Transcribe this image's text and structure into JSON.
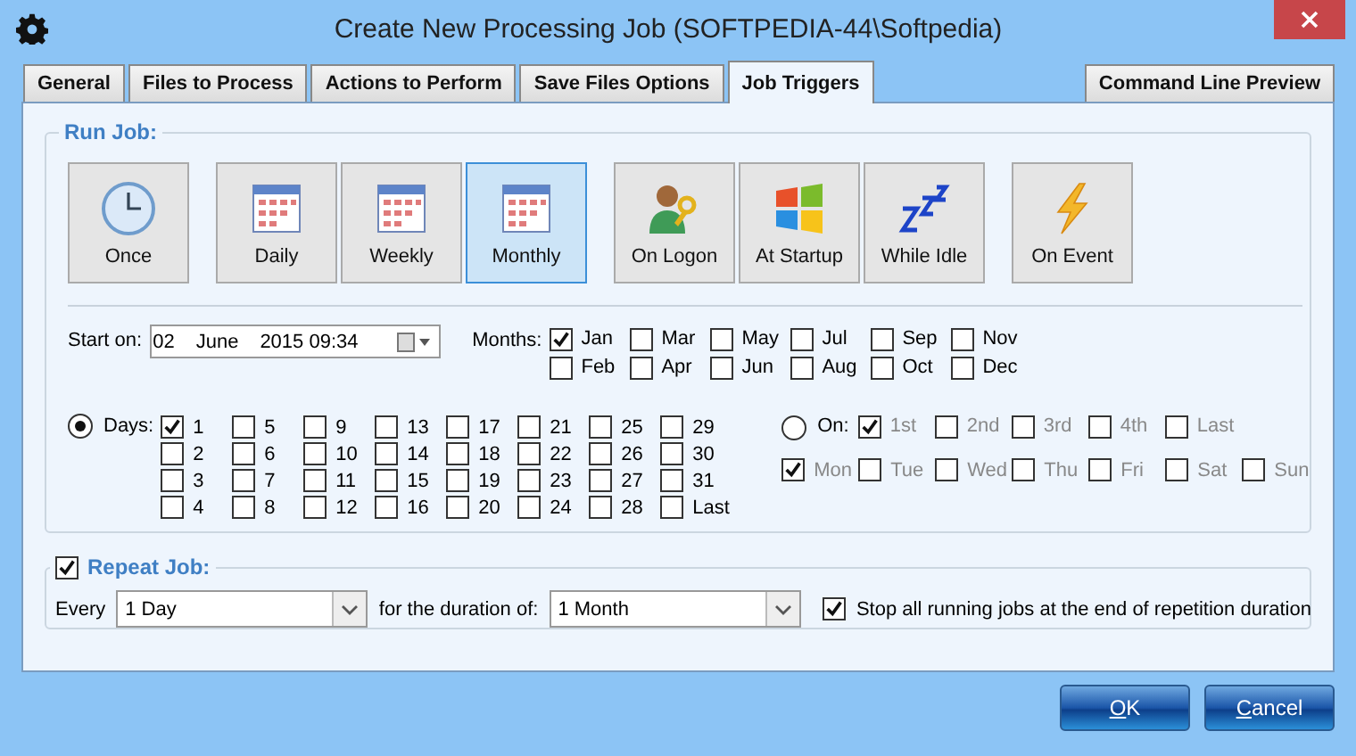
{
  "window": {
    "title": "Create New Processing Job (SOFTPEDIA-44\\Softpedia)"
  },
  "tabs": [
    {
      "label": "General",
      "selected": false
    },
    {
      "label": "Files to Process",
      "selected": false
    },
    {
      "label": "Actions to Perform",
      "selected": false
    },
    {
      "label": "Save Files Options",
      "selected": false
    },
    {
      "label": "Job Triggers",
      "selected": true
    }
  ],
  "side_tab": {
    "label": "Command Line Preview",
    "selected": false
  },
  "run_job": {
    "title": "Run Job:",
    "trigger_groups": [
      [
        {
          "label": "Once",
          "kind": "clock",
          "selected": false
        }
      ],
      [
        {
          "label": "Daily",
          "kind": "calendar",
          "selected": false
        },
        {
          "label": "Weekly",
          "kind": "calendar",
          "selected": false
        },
        {
          "label": "Monthly",
          "kind": "calendar",
          "selected": true
        }
      ],
      [
        {
          "label": "On Logon",
          "kind": "user",
          "selected": false
        },
        {
          "label": "At Startup",
          "kind": "flag",
          "selected": false
        },
        {
          "label": "While Idle",
          "kind": "sleep",
          "selected": false
        }
      ],
      [
        {
          "label": "On Event",
          "kind": "bolt",
          "selected": false
        }
      ]
    ]
  },
  "start_on": {
    "label": "Start on:",
    "day": "02",
    "month": "June",
    "year_time": "2015 09:34"
  },
  "months": {
    "label": "Months:",
    "items": [
      {
        "label": "Jan",
        "checked": true
      },
      {
        "label": "Feb",
        "checked": false
      },
      {
        "label": "Mar",
        "checked": false
      },
      {
        "label": "Apr",
        "checked": false
      },
      {
        "label": "May",
        "checked": false
      },
      {
        "label": "Jun",
        "checked": false
      },
      {
        "label": "Jul",
        "checked": false
      },
      {
        "label": "Aug",
        "checked": false
      },
      {
        "label": "Sep",
        "checked": false
      },
      {
        "label": "Oct",
        "checked": false
      },
      {
        "label": "Nov",
        "checked": false
      },
      {
        "label": "Dec",
        "checked": false
      }
    ]
  },
  "days": {
    "label": "Days:",
    "selected": true,
    "items": [
      {
        "label": "1",
        "checked": true
      },
      {
        "label": "2",
        "checked": false
      },
      {
        "label": "3",
        "checked": false
      },
      {
        "label": "4",
        "checked": false
      },
      {
        "label": "5",
        "checked": false
      },
      {
        "label": "6",
        "checked": false
      },
      {
        "label": "7",
        "checked": false
      },
      {
        "label": "8",
        "checked": false
      },
      {
        "label": "9",
        "checked": false
      },
      {
        "label": "10",
        "checked": false
      },
      {
        "label": "11",
        "checked": false
      },
      {
        "label": "12",
        "checked": false
      },
      {
        "label": "13",
        "checked": false
      },
      {
        "label": "14",
        "checked": false
      },
      {
        "label": "15",
        "checked": false
      },
      {
        "label": "16",
        "checked": false
      },
      {
        "label": "17",
        "checked": false
      },
      {
        "label": "18",
        "checked": false
      },
      {
        "label": "19",
        "checked": false
      },
      {
        "label": "20",
        "checked": false
      },
      {
        "label": "21",
        "checked": false
      },
      {
        "label": "22",
        "checked": false
      },
      {
        "label": "23",
        "checked": false
      },
      {
        "label": "24",
        "checked": false
      },
      {
        "label": "25",
        "checked": false
      },
      {
        "label": "26",
        "checked": false
      },
      {
        "label": "27",
        "checked": false
      },
      {
        "label": "28",
        "checked": false
      },
      {
        "label": "29",
        "checked": false
      },
      {
        "label": "30",
        "checked": false
      },
      {
        "label": "31",
        "checked": false
      },
      {
        "label": "Last",
        "checked": false
      }
    ]
  },
  "on": {
    "label": "On:",
    "selected": false,
    "disabled": true,
    "ordinals": [
      {
        "label": "1st",
        "checked": true
      },
      {
        "label": "2nd",
        "checked": false
      },
      {
        "label": "3rd",
        "checked": false
      },
      {
        "label": "4th",
        "checked": false
      },
      {
        "label": "Last",
        "checked": false
      }
    ],
    "weekdays": [
      {
        "label": "Mon",
        "checked": true
      },
      {
        "label": "Tue",
        "checked": false
      },
      {
        "label": "Wed",
        "checked": false
      },
      {
        "label": "Thu",
        "checked": false
      },
      {
        "label": "Fri",
        "checked": false
      },
      {
        "label": "Sat",
        "checked": false
      },
      {
        "label": "Sun",
        "checked": false
      }
    ]
  },
  "repeat": {
    "label": "Repeat Job:",
    "checked": true,
    "every_label": "Every",
    "every_value": "1 Day",
    "duration_label": "for the duration of:",
    "duration_value": "1 Month",
    "stop_label": "Stop all running jobs at the end of repetition duration",
    "stop_checked": true
  },
  "buttons": [
    {
      "label": "OK"
    },
    {
      "label": "Cancel"
    }
  ]
}
